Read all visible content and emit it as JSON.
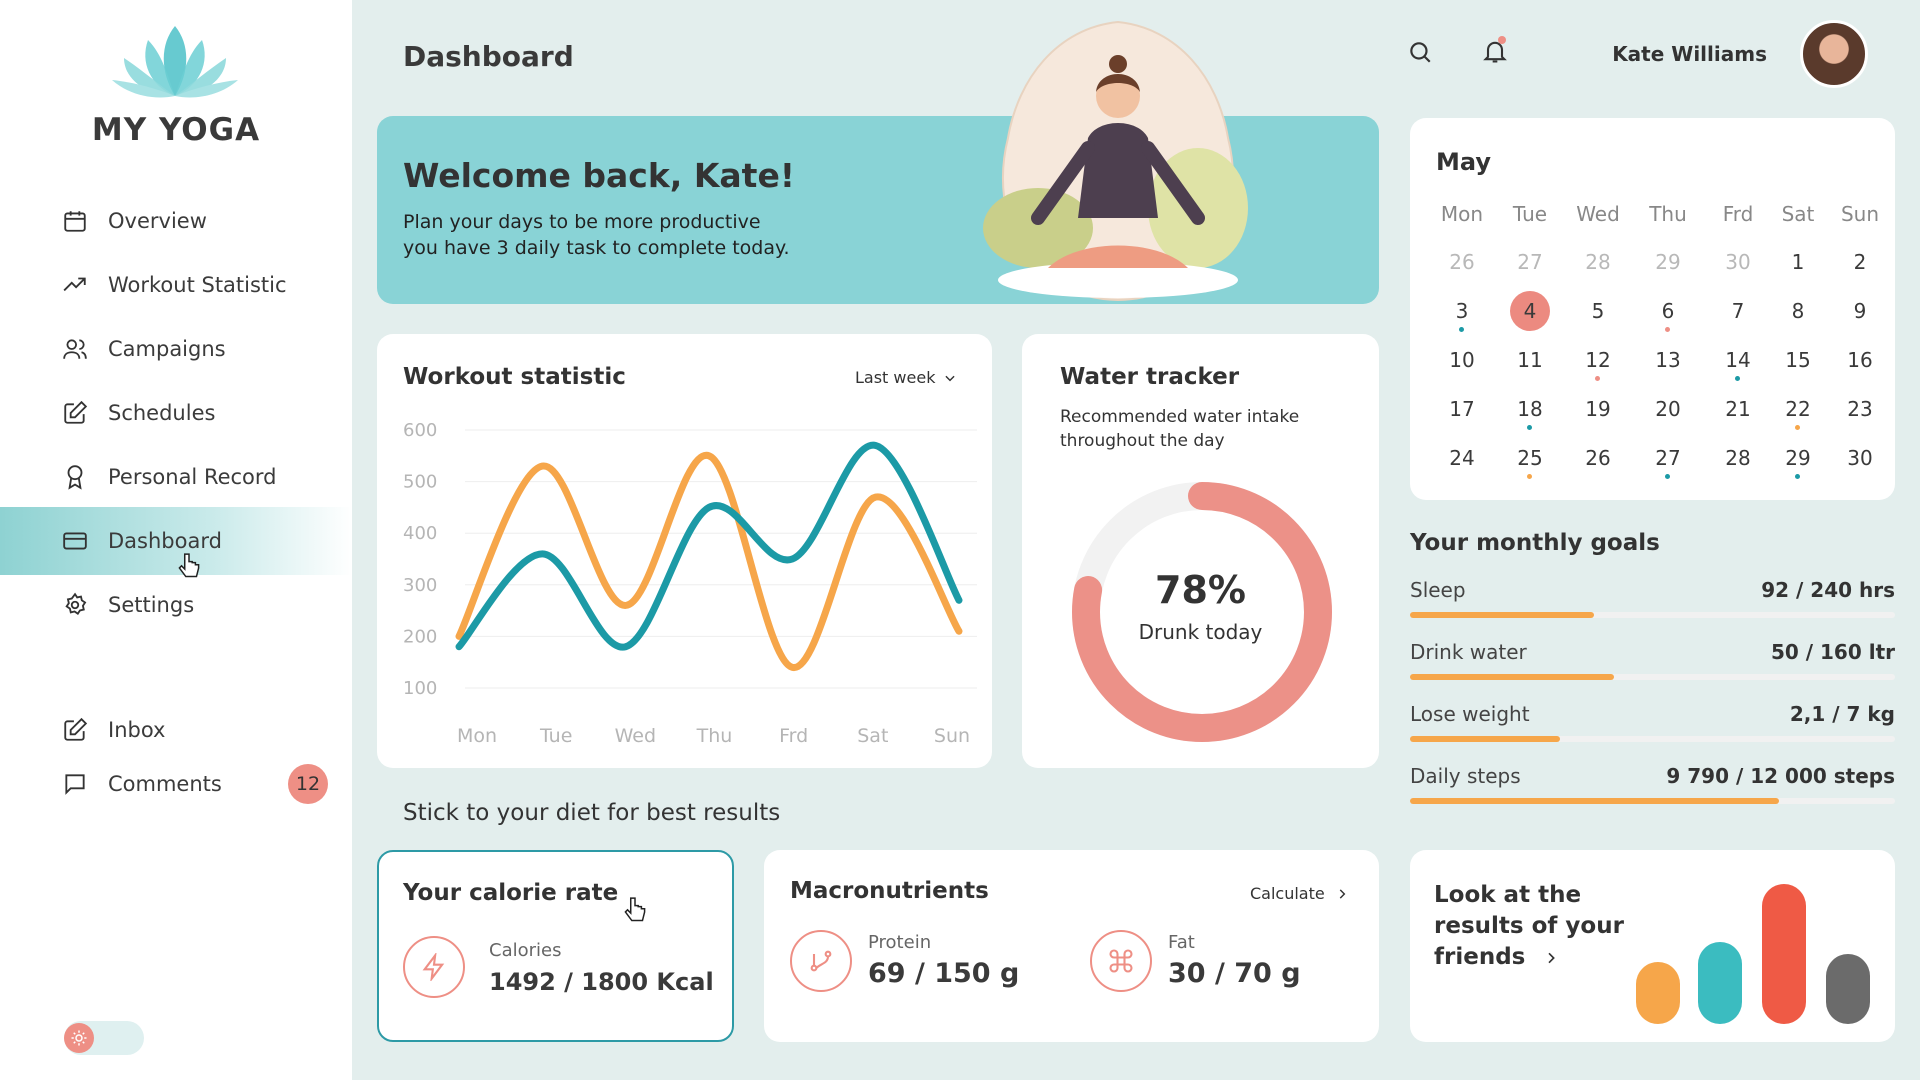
{
  "app": {
    "name": "MY YOGA"
  },
  "sidebar": {
    "items": [
      {
        "label": "Overview",
        "icon": "calendar-icon"
      },
      {
        "label": "Workout Statistic",
        "icon": "trending-up-icon"
      },
      {
        "label": "Campaigns",
        "icon": "users-icon"
      },
      {
        "label": "Schedules",
        "icon": "edit-icon"
      },
      {
        "label": "Personal Record",
        "icon": "award-icon"
      },
      {
        "label": "Dashboard",
        "icon": "credit-card-icon",
        "active": true
      },
      {
        "label": "Settings",
        "icon": "gear-icon"
      }
    ],
    "bottom_items": [
      {
        "label": "Inbox",
        "icon": "edit-icon"
      },
      {
        "label": "Comments",
        "icon": "message-icon",
        "badge": "12"
      }
    ]
  },
  "header": {
    "title": "Dashboard",
    "user_name": "Kate Williams"
  },
  "welcome": {
    "title": "Welcome back, Kate!",
    "line1": "Plan your days to be more productive",
    "line2": "you have 3 daily task to complete today."
  },
  "workout": {
    "title": "Workout statistic",
    "period": "Last week",
    "chart_data": {
      "type": "line",
      "categories": [
        "Mon",
        "Tue",
        "Wed",
        "Thu",
        "Frd",
        "Sat",
        "Sun"
      ],
      "yticks": [
        600,
        500,
        400,
        300,
        200,
        100
      ],
      "ylim": [
        100,
        600
      ],
      "series": [
        {
          "color": "#f6a64a",
          "values": [
            200,
            530,
            260,
            550,
            140,
            470,
            210
          ]
        },
        {
          "color": "#1c9aa6",
          "values": [
            180,
            360,
            180,
            450,
            350,
            570,
            270
          ]
        }
      ]
    }
  },
  "water": {
    "title": "Water tracker",
    "subtitle1": "Recommended water intake",
    "subtitle2": "throughout the day",
    "percent": "78%",
    "percent_value": 0.78,
    "caption": "Drunk today"
  },
  "calendar": {
    "month": "May",
    "weekdays": [
      "Mon",
      "Tue",
      "Wed",
      "Thu",
      "Frd",
      "Sat",
      "Sun"
    ],
    "weeks": [
      [
        "26",
        "27",
        "28",
        "29",
        "30",
        "1",
        "2"
      ],
      [
        "3",
        "4",
        "5",
        "6",
        "7",
        "8",
        "9"
      ],
      [
        "10",
        "11",
        "12",
        "13",
        "14",
        "15",
        "16"
      ],
      [
        "17",
        "18",
        "19",
        "20",
        "21",
        "22",
        "23"
      ],
      [
        "24",
        "25",
        "26",
        "27",
        "28",
        "29",
        "30"
      ]
    ],
    "selected": "4"
  },
  "goals": {
    "title": "Your monthly goals",
    "items": [
      {
        "label": "Sleep",
        "value": "92 / 240 hrs",
        "progress": 0.38
      },
      {
        "label": "Drink water",
        "value": "50 / 160 ltr",
        "progress": 0.42
      },
      {
        "label": "Lose weight",
        "value": "2,1 / 7 kg",
        "progress": 0.31
      },
      {
        "label": "Daily steps",
        "value": "9 790 / 12 000 steps",
        "progress": 0.76
      }
    ]
  },
  "diet": {
    "title": "Stick to your diet for best results",
    "calorie": {
      "title": "Your calorie rate",
      "label": "Calories",
      "value": "1492 / 1800 Kcal"
    },
    "macros": {
      "title": "Macronutrients",
      "action": "Calculate",
      "protein_label": "Protein",
      "protein_value": "69 / 150 g",
      "fat_label": "Fat",
      "fat_value": "30 / 70 g"
    },
    "friends": {
      "line1": "Look at the",
      "line2": "results of your",
      "line3": "friends"
    }
  },
  "colors": {
    "accent": "#89d3d6",
    "coral": "#ee8f85",
    "orange": "#f6a64a",
    "teal": "#1c9aa6"
  }
}
